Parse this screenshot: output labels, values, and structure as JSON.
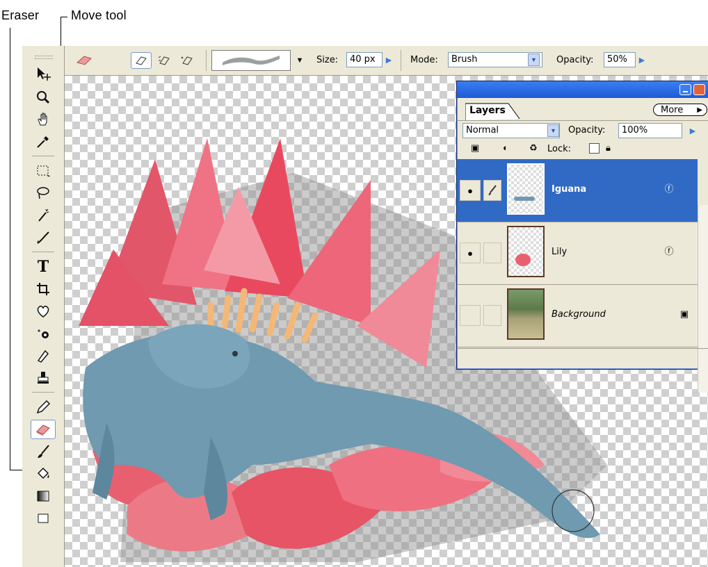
{
  "callouts": {
    "eraser": "Eraser",
    "move_tool": "Move tool"
  },
  "options_bar": {
    "size_label": "Size:",
    "size_value": "40 px",
    "mode_label": "Mode:",
    "mode_value": "Brush",
    "opacity_label": "Opacity:",
    "opacity_value": "50%"
  },
  "layers_palette": {
    "tab_label": "Layers",
    "more_label": "More",
    "blend_mode": "Normal",
    "opacity_label": "Opacity:",
    "opacity_value": "100%",
    "lock_label": "Lock:",
    "layers": [
      {
        "name": "Iguana",
        "visible": true,
        "selected": true
      },
      {
        "name": "Lily",
        "visible": true,
        "selected": false
      },
      {
        "name": "Background",
        "visible": false,
        "selected": false,
        "locked": true
      }
    ]
  },
  "colors": {
    "selection": "#316ac5",
    "title_bar": "#2a68e2",
    "panel": "#ece9d8"
  },
  "icons": [
    "move-icon",
    "zoom-icon",
    "hand-icon",
    "eyedropper-icon",
    "marquee-icon",
    "lasso-icon",
    "magic-wand-icon",
    "brush-select-icon",
    "type-icon",
    "crop-icon",
    "healing-icon",
    "red-eye-icon",
    "clone-stamp-icon",
    "stamp-icon",
    "pencil-icon",
    "eraser-icon",
    "brush-icon",
    "paint-bucket-icon",
    "gradient-icon"
  ]
}
